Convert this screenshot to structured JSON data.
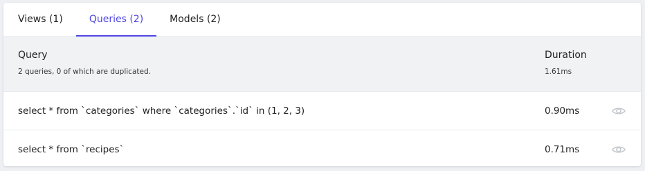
{
  "tabs": [
    {
      "label": "Views (1)"
    },
    {
      "label": "Queries (2)"
    },
    {
      "label": "Models (2)"
    }
  ],
  "active_tab": "Queries (2)",
  "header": {
    "query_label": "Query",
    "query_summary": "2 queries, 0 of which are duplicated.",
    "duration_label": "Duration",
    "duration_total": "1.61ms"
  },
  "queries": [
    {
      "sql": "select * from `categories` where `categories`.`id` in (1, 2, 3)",
      "duration": "0.90ms",
      "icon": "eye-icon"
    },
    {
      "sql": "select * from `recipes`",
      "duration": "0.71ms",
      "icon": "eye-icon"
    }
  ],
  "colors": {
    "accent": "#4f46e5",
    "header_bg": "#f0f2f4",
    "icon": "#c4c8cd"
  }
}
